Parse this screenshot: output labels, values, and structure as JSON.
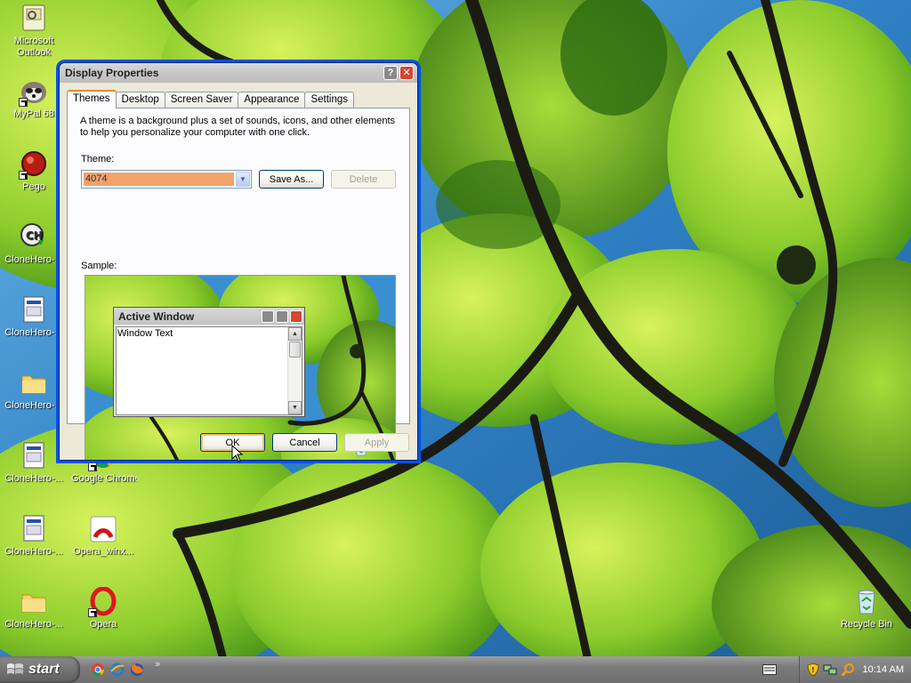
{
  "desktop": {
    "icons": [
      {
        "label": "Microsoft Outlook",
        "icon": "outlook-icon"
      },
      {
        "label": "MyPal 68",
        "icon": "mypal-icon"
      },
      {
        "label": "Pego",
        "icon": "pego-icon"
      },
      {
        "label": "CloneHero-...",
        "icon": "clonehero-icon"
      },
      {
        "label": "CloneHero-...",
        "icon": "document-icon"
      },
      {
        "label": "CloneHero-...",
        "icon": "folder-icon"
      },
      {
        "label": "CloneHero-...",
        "icon": "document-icon"
      },
      {
        "label": "CloneHero-...",
        "icon": "document-icon"
      },
      {
        "label": "CloneHero-...",
        "icon": "folder-icon"
      },
      {
        "label": "Google Chrome",
        "icon": "chrome-icon"
      },
      {
        "label": "Opera_winx...",
        "icon": "opera-installer-icon"
      },
      {
        "label": "Opera",
        "icon": "opera-icon"
      },
      {
        "label": "Recycle Bin",
        "icon": "recycle-bin-icon"
      }
    ]
  },
  "dialog": {
    "title": "Display Properties",
    "help_glyph": "?",
    "close_glyph": "✕",
    "tabs": [
      {
        "label": "Themes",
        "active": true
      },
      {
        "label": "Desktop"
      },
      {
        "label": "Screen Saver"
      },
      {
        "label": "Appearance"
      },
      {
        "label": "Settings"
      }
    ],
    "description": "A theme is a background plus a set of sounds, icons, and other elements to help you personalize your computer with one click.",
    "theme_label": "Theme:",
    "theme_value": "4074",
    "save_as": "Save As...",
    "delete": "Delete",
    "sample_label": "Sample:",
    "sample_window_title": "Active Window",
    "sample_window_text": "Window Text",
    "ok": "OK",
    "cancel": "Cancel",
    "apply": "Apply"
  },
  "taskbar": {
    "start_label": "start",
    "chevron": "»",
    "clock": "10:14 AM"
  },
  "colors": {
    "selection": "#f2a36c",
    "wallpaper_leaf": "#8ccc2c",
    "wallpaper_sky": "#3a8fd0",
    "default_button_ring": "#f7c45d"
  }
}
